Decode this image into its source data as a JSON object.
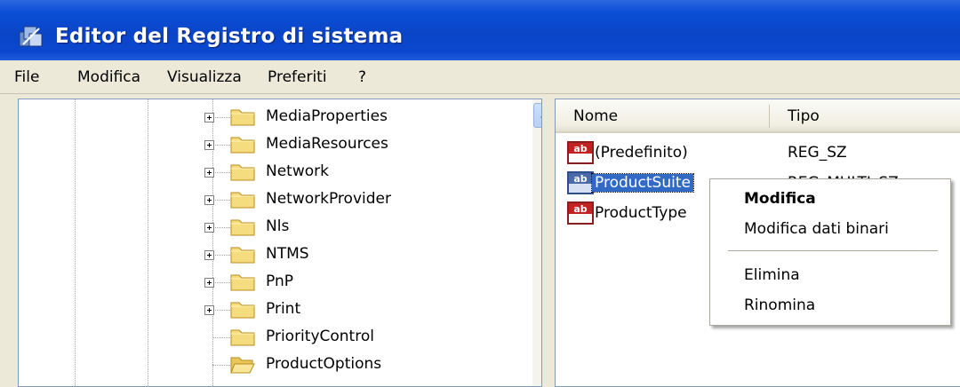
{
  "window": {
    "title": "Editor del Registro di sistema"
  },
  "menubar": [
    "File",
    "Modifica",
    "Visualizza",
    "Preferiti",
    "?"
  ],
  "tree": {
    "nodes": [
      {
        "label": "MediaProperties",
        "expandable": true
      },
      {
        "label": "MediaResources",
        "expandable": true
      },
      {
        "label": "Network",
        "expandable": true
      },
      {
        "label": "NetworkProvider",
        "expandable": true
      },
      {
        "label": "Nls",
        "expandable": true
      },
      {
        "label": "NTMS",
        "expandable": true
      },
      {
        "label": "PnP",
        "expandable": true
      },
      {
        "label": "Print",
        "expandable": true
      },
      {
        "label": "PriorityControl",
        "expandable": false
      },
      {
        "label": "ProductOptions",
        "expandable": false,
        "open": true
      }
    ]
  },
  "list": {
    "columns": [
      "Nome",
      "Tipo"
    ],
    "rows": [
      {
        "name": "(Predefinito)",
        "type": "REG_SZ",
        "selected": false
      },
      {
        "name": "ProductSuite",
        "type": "REG_MULTI_SZ",
        "selected": true
      },
      {
        "name": "ProductType",
        "type": "",
        "selected": false
      }
    ]
  },
  "context_menu": {
    "items": [
      {
        "label": "Modifica",
        "bold": true
      },
      {
        "label": "Modifica dati binari"
      },
      {
        "label": "Elimina"
      },
      {
        "label": "Rinomina"
      }
    ]
  },
  "colors": {
    "titlebar": "#0a45c8",
    "selection": "#316ac5",
    "pane_border": "#7f9db9"
  },
  "icons": [
    "registry-editor-icon",
    "folder-icon",
    "open-folder-icon",
    "string-value-icon",
    "multi-string-value-icon",
    "scroll-up-arrow-icon"
  ]
}
